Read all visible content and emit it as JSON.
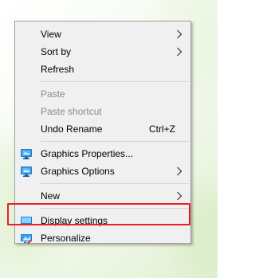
{
  "menu": {
    "items": [
      {
        "label": "View",
        "submenu": true
      },
      {
        "label": "Sort by",
        "submenu": true
      },
      {
        "label": "Refresh"
      },
      {
        "label": "Paste",
        "disabled": true
      },
      {
        "label": "Paste shortcut",
        "disabled": true
      },
      {
        "label": "Undo Rename",
        "shortcut": "Ctrl+Z"
      },
      {
        "label": "Graphics Properties...",
        "icon": "graphics-icon"
      },
      {
        "label": "Graphics Options",
        "icon": "graphics-icon",
        "submenu": true
      },
      {
        "label": "New",
        "submenu": true
      },
      {
        "label": "Display settings",
        "icon": "display-icon",
        "highlighted": true
      },
      {
        "label": "Personalize",
        "icon": "personalize-icon"
      }
    ]
  },
  "colors": {
    "menu_bg": "#f0f0f0",
    "highlight_border": "#e8202a",
    "disabled_text": "#8a8a8a",
    "accent": "#1a7fd6"
  }
}
